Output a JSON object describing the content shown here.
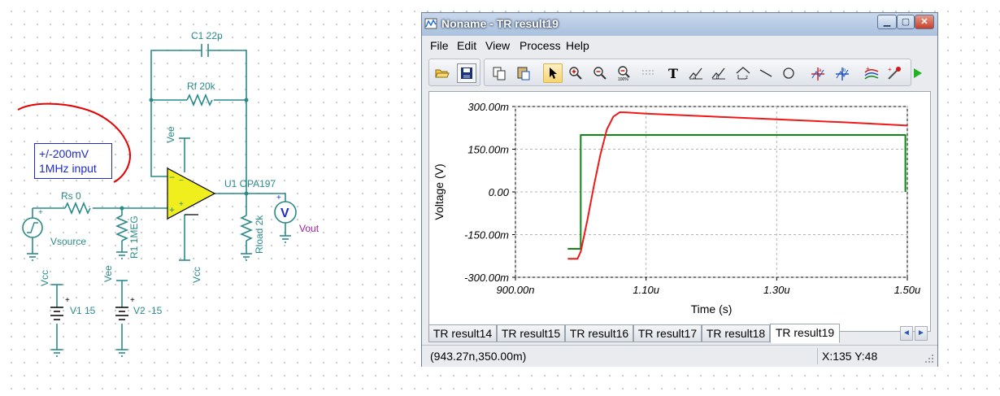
{
  "schematic": {
    "c1_label": "C1 22p",
    "rf_label": "Rf 20k",
    "rs_label": "Rs 0",
    "r1_label": "R1 1MEG",
    "u1_label": "U1 OPA197",
    "rload_label": "Rload 2k",
    "vsource_label": "Vsource",
    "vout_label": "Vout",
    "vee_top_label": "Vee",
    "vcc_bottom_label": "Vcc",
    "vcc_supply_label": "Vcc",
    "vee_supply_label": "Vee",
    "v1_label": "V1 15",
    "v2_label": "V2 -15",
    "meter_symbol": "V",
    "input_note_line1": "+/-200mV",
    "input_note_line2": "1MHz input"
  },
  "window": {
    "title": "Noname - TR result19",
    "menu": [
      "File",
      "Edit",
      "View",
      "Process",
      "Help"
    ],
    "toolbar_icons": [
      "open-folder-icon",
      "save-icon",
      "copy-icon",
      "paste-icon",
      "pointer-icon",
      "zoom-in-icon",
      "zoom-out-icon",
      "zoom-100-icon",
      "grid-icon",
      "text-icon",
      "cursor-a-icon",
      "cursor-b-icon",
      "envelope-icon",
      "line-icon",
      "circle-icon",
      "cursor-a-place-icon",
      "cursor-b-place-icon",
      "add-curve-icon",
      "probe-icon",
      "run-icon"
    ],
    "tabs": [
      "TR result14",
      "TR result15",
      "TR result16",
      "TR result17",
      "TR result18",
      "TR result19"
    ],
    "active_tab": "TR result19",
    "status_left": "(943.27n,350.00m)",
    "status_right": "X:135  Y:48"
  },
  "chart_data": {
    "type": "line",
    "title": "",
    "xlabel": "Time (s)",
    "ylabel": "Voltage (V)",
    "x_tick_labels": [
      "900.00n",
      "1.10u",
      "1.30u",
      "1.50u"
    ],
    "x_ticks": [
      0.9,
      1.1,
      1.3,
      1.5
    ],
    "y_tick_labels": [
      "300.00m",
      "150.00m",
      "0.00",
      "-150.00m",
      "-300.00m"
    ],
    "y_ticks": [
      0.3,
      0.15,
      0,
      -0.15,
      -0.3
    ],
    "xlim": [
      0.9,
      1.5
    ],
    "ylim": [
      -0.3,
      0.3
    ],
    "x_unit": "us",
    "grid": true,
    "series": [
      {
        "color": "#0b8a12",
        "x": [
          0.98,
          0.999,
          1.0,
          1.0,
          1.497,
          1.497
        ],
        "y": [
          -0.2,
          -0.2,
          -0.2,
          0.2,
          0.2,
          0.0
        ]
      },
      {
        "color": "#f01818",
        "x": [
          0.98,
          0.995,
          1.0,
          1.01,
          1.02,
          1.03,
          1.04,
          1.05,
          1.06,
          1.07,
          1.1,
          1.2,
          1.3,
          1.4,
          1.5
        ],
        "y": [
          -0.235,
          -0.235,
          -0.21,
          -0.1,
          0.02,
          0.13,
          0.22,
          0.265,
          0.28,
          0.279,
          0.275,
          0.265,
          0.255,
          0.245,
          0.233
        ]
      }
    ]
  },
  "colors": {
    "accent": "#1e2ad0",
    "wire": "#1b7f7f",
    "opamp": "#f0ef1d",
    "red_annotation": "#e60000"
  }
}
